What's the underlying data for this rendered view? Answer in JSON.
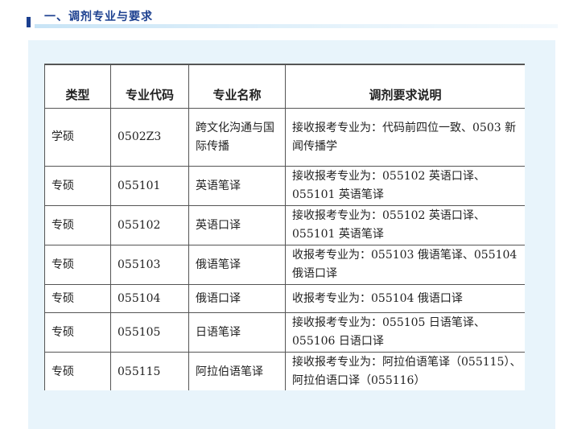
{
  "section": {
    "title": "一、调剂专业与要求"
  },
  "table": {
    "headers": [
      "类型",
      "专业代码",
      "专业名称",
      "调剂要求说明"
    ],
    "rows": [
      {
        "type": "学硕",
        "code": "0502Z3",
        "name": "跨文化沟通与国际传播",
        "note": "接收报考专业为：代码前四位一致、0503 新闻传播学"
      },
      {
        "type": "专硕",
        "code": "055101",
        "name": "英语笔译",
        "note": "接收报考专业为：055102 英语口译、055101 英语笔译"
      },
      {
        "type": "专硕",
        "code": "055102",
        "name": "英语口译",
        "note": "接收报考专业为：055102 英语口译、055101 英语笔译"
      },
      {
        "type": "专硕",
        "code": "055103",
        "name": "俄语笔译",
        "note": "收报考专业为：055103 俄语笔译、055104 俄语口译"
      },
      {
        "type": "专硕",
        "code": "055104",
        "name": "俄语口译",
        "note": "收报考专业为：055104 俄语口译"
      },
      {
        "type": "专硕",
        "code": "055105",
        "name": "日语笔译",
        "note": "接收报考专业为：055105 日语笔译、055106 日语口译"
      },
      {
        "type": "专硕",
        "code": "055115",
        "name": "阿拉伯语笔译",
        "note": "接收报考专业为：阿拉伯语笔译（055115）、阿拉伯语口译（055116）"
      }
    ]
  }
}
